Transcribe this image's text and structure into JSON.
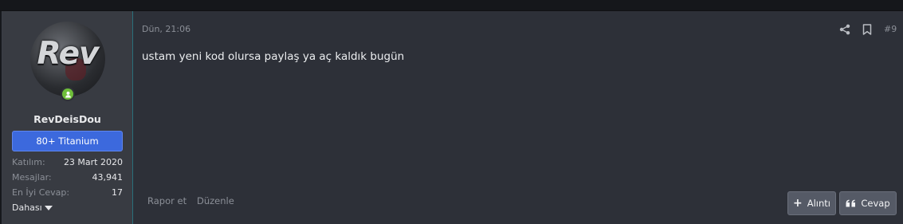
{
  "user": {
    "avatar_text": "Rev",
    "username": "RevDeisDou",
    "banner": "80+ Titanium",
    "stats": [
      {
        "label": "Katılım:",
        "value": "23 Mart 2020"
      },
      {
        "label": "Mesajlar:",
        "value": "43,941"
      },
      {
        "label": "En İyi Cevap:",
        "value": "17"
      }
    ],
    "more_label": "Dahası",
    "online_color": "#6fbf3a",
    "banner_color": "#3c69dd"
  },
  "post": {
    "date": "Dün, 21:06",
    "number": "#9",
    "message": "ustam yeni kod olursa paylaş ya aç kaldık bugün",
    "share_icon": "share-icon",
    "bookmark_icon": "bookmark-icon"
  },
  "actions": {
    "report": "Rapor et",
    "edit": "Düzenle",
    "quote": "Alıntı",
    "reply": "Cevap"
  }
}
